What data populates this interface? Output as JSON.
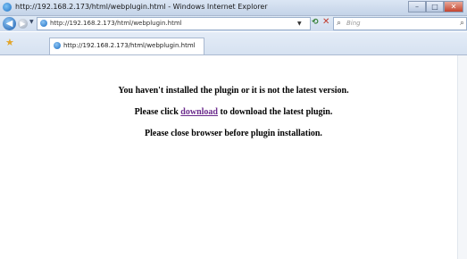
{
  "window": {
    "title": "http://192.168.2.173/html/webplugin.html - Windows Internet Explorer",
    "controls": {
      "minimize": "–",
      "maximize": "□",
      "close": "✕"
    }
  },
  "address_bar": {
    "url": "http://192.168.2.173/html/webplugin.html"
  },
  "search": {
    "placeholder": "Bing"
  },
  "tab": {
    "label": "http://192.168.2.173/html/webplugin.html"
  },
  "page": {
    "line1": "You haven't installed the plugin or it is not the latest version.",
    "line2_before": "Please click ",
    "line2_link": "download",
    "line2_after": " to download the latest plugin.",
    "line3": "Please close browser before plugin installation."
  },
  "icons": {
    "back": "back-arrow-icon",
    "forward": "forward-arrow-icon",
    "page": "ie-page-icon",
    "refresh": "refresh-icon",
    "stop": "stop-icon",
    "search": "search-icon",
    "favorites": "favorites-star-icon"
  },
  "colors": {
    "link": "#6b2b8c",
    "chrome": "#dbe6f4"
  }
}
